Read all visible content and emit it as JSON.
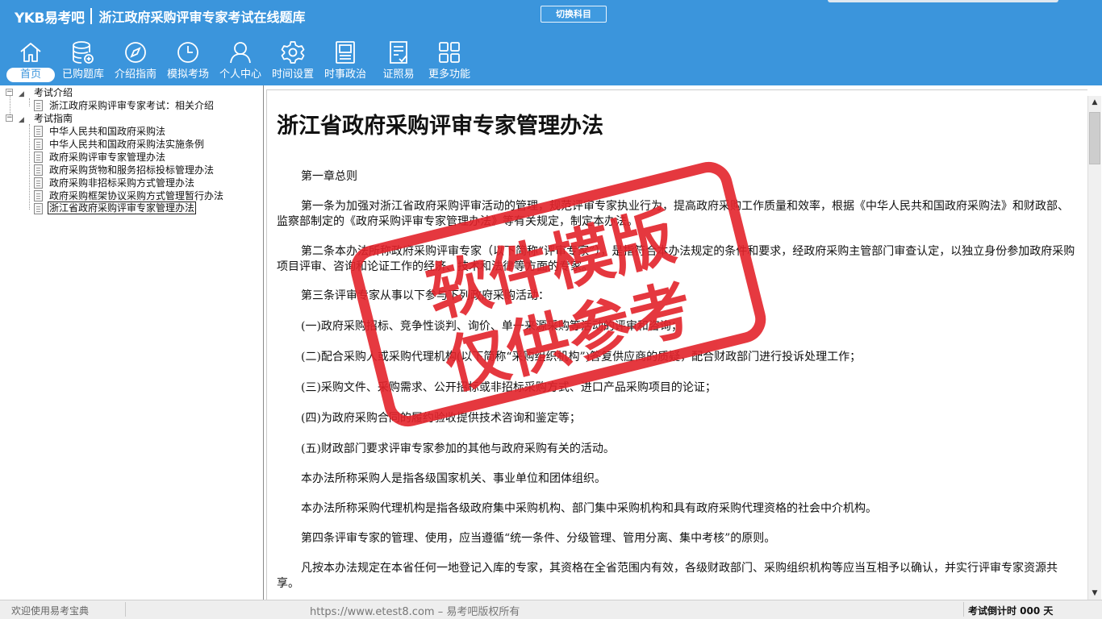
{
  "header": {
    "logo": "YKB易考吧",
    "title": "浙江政府采购评审专家考试在线题库",
    "switch_button": "切换科目"
  },
  "nav": [
    {
      "label": "首页",
      "icon": "home-icon"
    },
    {
      "label": "已购题库",
      "icon": "database-icon"
    },
    {
      "label": "介绍指南",
      "icon": "compass-icon"
    },
    {
      "label": "模拟考场",
      "icon": "clock-icon"
    },
    {
      "label": "个人中心",
      "icon": "user-icon"
    },
    {
      "label": "时间设置",
      "icon": "gear-icon"
    },
    {
      "label": "时事政治",
      "icon": "news-icon"
    },
    {
      "label": "证照易",
      "icon": "checklist-icon"
    },
    {
      "label": "更多功能",
      "icon": "grid-icon"
    }
  ],
  "tree": {
    "groups": [
      {
        "label": "考试介绍",
        "items": [
          "浙江政府采购评审专家考试：相关介绍"
        ]
      },
      {
        "label": "考试指南",
        "items": [
          "中华人民共和国政府采购法",
          "中华人民共和国政府采购法实施条例",
          "政府采购评审专家管理办法",
          "政府采购货物和服务招标投标管理办法",
          "政府采购非招标采购方式管理办法",
          "政府采购框架协议采购方式管理暂行办法",
          "浙江省政府采购评审专家管理办法"
        ]
      }
    ]
  },
  "document": {
    "title": "浙江省政府采购评审专家管理办法",
    "paragraphs": [
      "第一章总则",
      "第一条为加强对浙江省政府采购评审活动的管理，规范评审专家执业行为，提高政府采购工作质量和效率，根据《中华人民共和国政府采购法》和财政部、监察部制定的《政府采购评审专家管理办法》等有关规定，制定本办法。",
      "第二条本办法所称政府采购评审专家（以下简称“评审专家”），是指符合本办法规定的条件和要求，经政府采购主管部门审查认定，以独立身份参加政府采购项目评审、咨询和论证工作的经济、技术和法律等方面的专家。",
      "第三条评审专家从事以下参与下列政府采购活动：",
      "(一)政府采购招标、竞争性谈判、询价、单一来源采购等活动的评审和咨询；",
      "(二)配合采购人或采购代理机构(以下简称“采购组织机构”)答复供应商的质疑，配合财政部门进行投诉处理工作；",
      "(三)采购文件、采购需求、公开招标或非招标采购方式、进口产品采购项目的论证；",
      "(四)为政府采购合同的履约验收提供技术咨询和鉴定等；",
      "(五)财政部门要求评审专家参加的其他与政府采购有关的活动。",
      "本办法所称采购人是指各级国家机关、事业单位和团体组织。",
      "本办法所称采购代理机构是指各级政府集中采购机构、部门集中采购机构和具有政府采购代理资格的社会中介机构。",
      "第四条评审专家的管理、使用，应当遵循“统一条件、分级管理、管用分离、集中考核”的原则。",
      "凡按本办法规定在本省任何一地登记入库的专家，其资格在全省范围内有效，各级财政部门、采购组织机构等应当互相予以确认，并实行评审专家资源共享。"
    ]
  },
  "watermark": {
    "line1": "软件模版",
    "line2": "仅供参考",
    "color": "#e3232b"
  },
  "status": {
    "left": "欢迎使用易考宝典",
    "center": "https://www.etest8.com – 易考吧版权所有",
    "right": "考试倒计时 000 天"
  },
  "colors": {
    "primary": "#3b95dc"
  }
}
